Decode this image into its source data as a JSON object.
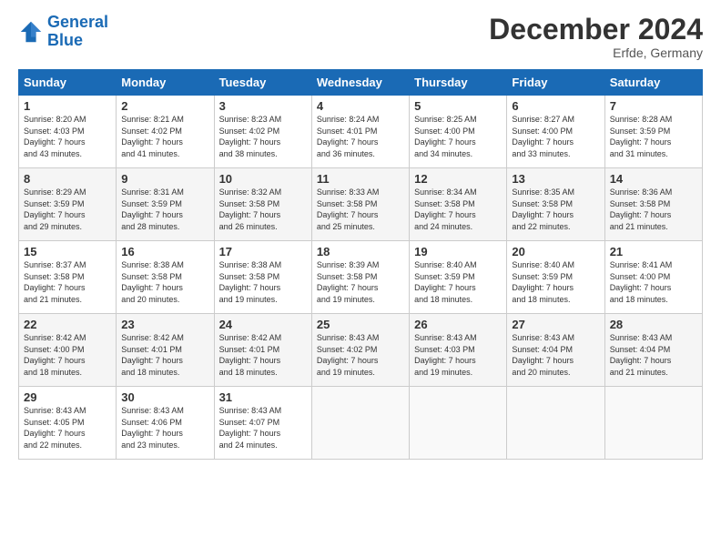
{
  "logo": {
    "line1": "General",
    "line2": "Blue"
  },
  "title": "December 2024",
  "subtitle": "Erfde, Germany",
  "days_header": [
    "Sunday",
    "Monday",
    "Tuesday",
    "Wednesday",
    "Thursday",
    "Friday",
    "Saturday"
  ],
  "weeks": [
    [
      {
        "day": "1",
        "info": "Sunrise: 8:20 AM\nSunset: 4:03 PM\nDaylight: 7 hours\nand 43 minutes."
      },
      {
        "day": "2",
        "info": "Sunrise: 8:21 AM\nSunset: 4:02 PM\nDaylight: 7 hours\nand 41 minutes."
      },
      {
        "day": "3",
        "info": "Sunrise: 8:23 AM\nSunset: 4:02 PM\nDaylight: 7 hours\nand 38 minutes."
      },
      {
        "day": "4",
        "info": "Sunrise: 8:24 AM\nSunset: 4:01 PM\nDaylight: 7 hours\nand 36 minutes."
      },
      {
        "day": "5",
        "info": "Sunrise: 8:25 AM\nSunset: 4:00 PM\nDaylight: 7 hours\nand 34 minutes."
      },
      {
        "day": "6",
        "info": "Sunrise: 8:27 AM\nSunset: 4:00 PM\nDaylight: 7 hours\nand 33 minutes."
      },
      {
        "day": "7",
        "info": "Sunrise: 8:28 AM\nSunset: 3:59 PM\nDaylight: 7 hours\nand 31 minutes."
      }
    ],
    [
      {
        "day": "8",
        "info": "Sunrise: 8:29 AM\nSunset: 3:59 PM\nDaylight: 7 hours\nand 29 minutes."
      },
      {
        "day": "9",
        "info": "Sunrise: 8:31 AM\nSunset: 3:59 PM\nDaylight: 7 hours\nand 28 minutes."
      },
      {
        "day": "10",
        "info": "Sunrise: 8:32 AM\nSunset: 3:58 PM\nDaylight: 7 hours\nand 26 minutes."
      },
      {
        "day": "11",
        "info": "Sunrise: 8:33 AM\nSunset: 3:58 PM\nDaylight: 7 hours\nand 25 minutes."
      },
      {
        "day": "12",
        "info": "Sunrise: 8:34 AM\nSunset: 3:58 PM\nDaylight: 7 hours\nand 24 minutes."
      },
      {
        "day": "13",
        "info": "Sunrise: 8:35 AM\nSunset: 3:58 PM\nDaylight: 7 hours\nand 22 minutes."
      },
      {
        "day": "14",
        "info": "Sunrise: 8:36 AM\nSunset: 3:58 PM\nDaylight: 7 hours\nand 21 minutes."
      }
    ],
    [
      {
        "day": "15",
        "info": "Sunrise: 8:37 AM\nSunset: 3:58 PM\nDaylight: 7 hours\nand 21 minutes."
      },
      {
        "day": "16",
        "info": "Sunrise: 8:38 AM\nSunset: 3:58 PM\nDaylight: 7 hours\nand 20 minutes."
      },
      {
        "day": "17",
        "info": "Sunrise: 8:38 AM\nSunset: 3:58 PM\nDaylight: 7 hours\nand 19 minutes."
      },
      {
        "day": "18",
        "info": "Sunrise: 8:39 AM\nSunset: 3:58 PM\nDaylight: 7 hours\nand 19 minutes."
      },
      {
        "day": "19",
        "info": "Sunrise: 8:40 AM\nSunset: 3:59 PM\nDaylight: 7 hours\nand 18 minutes."
      },
      {
        "day": "20",
        "info": "Sunrise: 8:40 AM\nSunset: 3:59 PM\nDaylight: 7 hours\nand 18 minutes."
      },
      {
        "day": "21",
        "info": "Sunrise: 8:41 AM\nSunset: 4:00 PM\nDaylight: 7 hours\nand 18 minutes."
      }
    ],
    [
      {
        "day": "22",
        "info": "Sunrise: 8:42 AM\nSunset: 4:00 PM\nDaylight: 7 hours\nand 18 minutes."
      },
      {
        "day": "23",
        "info": "Sunrise: 8:42 AM\nSunset: 4:01 PM\nDaylight: 7 hours\nand 18 minutes."
      },
      {
        "day": "24",
        "info": "Sunrise: 8:42 AM\nSunset: 4:01 PM\nDaylight: 7 hours\nand 18 minutes."
      },
      {
        "day": "25",
        "info": "Sunrise: 8:43 AM\nSunset: 4:02 PM\nDaylight: 7 hours\nand 19 minutes."
      },
      {
        "day": "26",
        "info": "Sunrise: 8:43 AM\nSunset: 4:03 PM\nDaylight: 7 hours\nand 19 minutes."
      },
      {
        "day": "27",
        "info": "Sunrise: 8:43 AM\nSunset: 4:04 PM\nDaylight: 7 hours\nand 20 minutes."
      },
      {
        "day": "28",
        "info": "Sunrise: 8:43 AM\nSunset: 4:04 PM\nDaylight: 7 hours\nand 21 minutes."
      }
    ],
    [
      {
        "day": "29",
        "info": "Sunrise: 8:43 AM\nSunset: 4:05 PM\nDaylight: 7 hours\nand 22 minutes."
      },
      {
        "day": "30",
        "info": "Sunrise: 8:43 AM\nSunset: 4:06 PM\nDaylight: 7 hours\nand 23 minutes."
      },
      {
        "day": "31",
        "info": "Sunrise: 8:43 AM\nSunset: 4:07 PM\nDaylight: 7 hours\nand 24 minutes."
      },
      {
        "day": "",
        "info": ""
      },
      {
        "day": "",
        "info": ""
      },
      {
        "day": "",
        "info": ""
      },
      {
        "day": "",
        "info": ""
      }
    ]
  ]
}
